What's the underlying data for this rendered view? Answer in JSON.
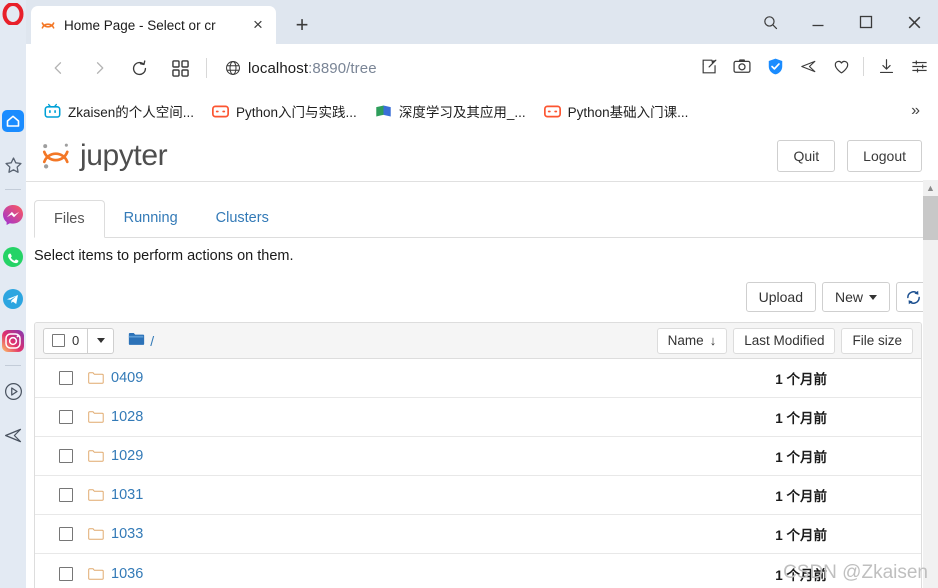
{
  "browser": {
    "tab": {
      "title": "Home Page - Select or cr",
      "favicon": "jupyter-icon",
      "close_label": "×"
    },
    "new_tab_label": "+",
    "window_controls": {
      "search": "search-icon",
      "minimize": "—",
      "maximize": "□",
      "close": "✕"
    },
    "nav": {
      "back": "back-arrow-icon",
      "forward": "forward-arrow-icon",
      "reload": "reload-icon",
      "tabs_overview": "grid-icon",
      "site_info": "globe-icon",
      "url_host": "localhost",
      "url_rest": ":8890/tree"
    },
    "toolbar_icons": [
      "snapshot-icon",
      "camera-icon",
      "vpn-shield-icon",
      "send-icon",
      "heart-icon",
      "download-icon",
      "settings-sliders-icon"
    ],
    "bookmarks": [
      {
        "label": "Zkaisen的个人空间...",
        "icon": "bilibili-icon"
      },
      {
        "label": "Python入门与实践...",
        "icon": "csdn-icon"
      },
      {
        "label": "深度学习及其应用_...",
        "icon": "book-icon"
      },
      {
        "label": "Python基础入门课...",
        "icon": "csdn-icon"
      }
    ],
    "bookmarks_overflow": "»"
  },
  "sidebar": {
    "items": [
      {
        "name": "home",
        "icon": "home-icon",
        "active": true
      },
      {
        "name": "favorites",
        "icon": "star-icon",
        "active": false
      },
      {
        "name": "messenger",
        "icon": "messenger-icon",
        "active": false
      },
      {
        "name": "whatsapp",
        "icon": "whatsapp-icon",
        "active": false
      },
      {
        "name": "telegram",
        "icon": "telegram-icon",
        "active": false
      },
      {
        "name": "instagram",
        "icon": "instagram-icon",
        "active": false
      },
      {
        "name": "player",
        "icon": "play-circle-icon",
        "active": false
      },
      {
        "name": "send",
        "icon": "send-outline-icon",
        "active": false
      }
    ]
  },
  "jupyter": {
    "logo_text": "jupyter",
    "quit_label": "Quit",
    "logout_label": "Logout",
    "tabs": [
      {
        "label": "Files",
        "active": true
      },
      {
        "label": "Running",
        "active": false
      },
      {
        "label": "Clusters",
        "active": false
      }
    ],
    "hint": "Select items to perform actions on them.",
    "toolbar": {
      "upload_label": "Upload",
      "new_label": "New",
      "refresh_icon": "refresh-icon"
    },
    "list_header": {
      "select_count": "0",
      "path": "/",
      "folder_icon": "folder-open-icon",
      "sort_name": "Name",
      "sort_name_arrow": "↓",
      "sort_modified": "Last Modified",
      "sort_size": "File size"
    },
    "files": [
      {
        "name": "0409",
        "modified": "1 个月前"
      },
      {
        "name": "1028",
        "modified": "1 个月前"
      },
      {
        "name": "1029",
        "modified": "1 个月前"
      },
      {
        "name": "1031",
        "modified": "1 个月前"
      },
      {
        "name": "1033",
        "modified": "1 个月前"
      },
      {
        "name": "1036",
        "modified": "1 个月前"
      }
    ]
  },
  "watermark": "CSDN @Zkaisen",
  "colors": {
    "accent_blue": "#337ab7",
    "jupyter_orange": "#f37726",
    "chrome_bg": "#dfe6ef"
  }
}
